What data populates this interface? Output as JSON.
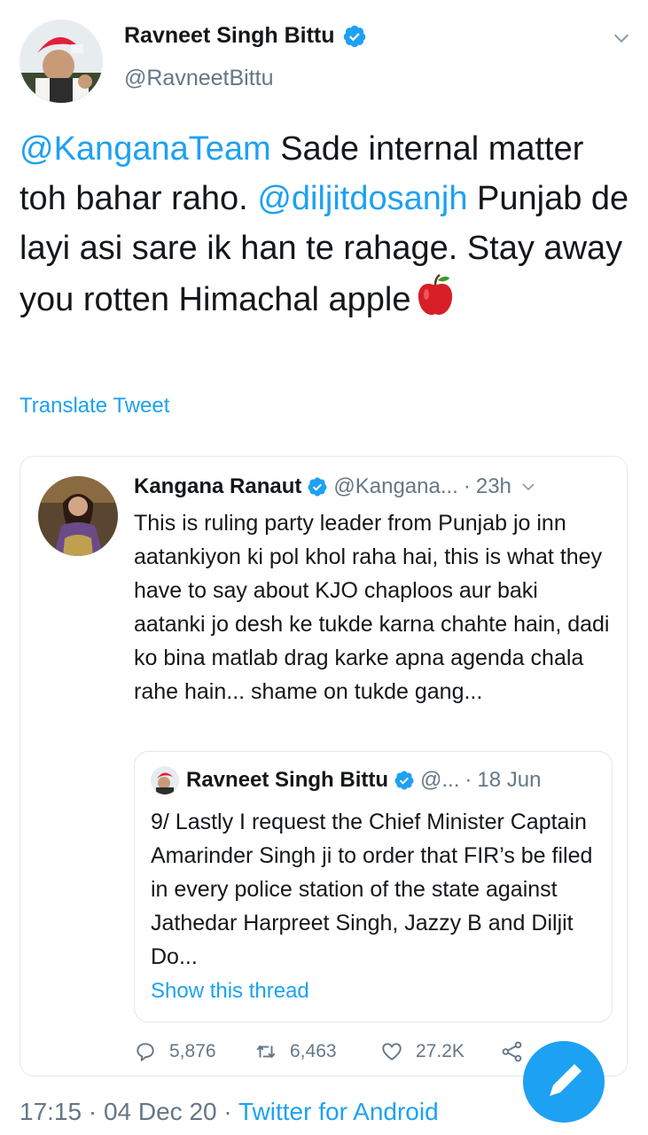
{
  "author": {
    "display_name": "Ravneet Singh Bittu",
    "handle": "@RavneetBittu"
  },
  "tweet": {
    "mention_1": "@KanganaTeam",
    "text_1": " Sade internal matter toh bahar raho. ",
    "mention_2": "@diljitdosanjh",
    "text_2": " Punjab de layi asi sare ik han te rahage. Stay away you rotten Himachal apple",
    "emoji": "red-apple-emoji"
  },
  "translate_label": "Translate Tweet",
  "quoted": {
    "display_name": "Kangana Ranaut",
    "handle": "@Kangana...",
    "separator": "·",
    "time": "23h",
    "text": "This is ruling party leader from Punjab jo inn aatankiyon ki pol khol raha hai, this is what they have to say about KJO chaploos aur baki aatanki jo desh ke tukde karna chahte hain, dadi ko bina matlab drag karke apna agenda chala rahe hain... shame on tukde gang...",
    "inner": {
      "display_name": "Ravneet Singh Bittu",
      "handle": "@...",
      "separator": "·",
      "time": "18 Jun",
      "text": "9/ Lastly I request the Chief Minister Captain Amarinder Singh ji to order that FIR’s be filed in every police station of the state against Jathedar Harpreet Singh, Jazzy B and Diljit Do...",
      "show_thread": "Show this thread"
    },
    "actions": {
      "replies": "5,876",
      "retweets": "6,463",
      "likes": "27.2K"
    }
  },
  "footer": {
    "time": "17:15",
    "separator_1": " · ",
    "date": "04 Dec 20",
    "separator_2": " · ",
    "source": "Twitter for Android"
  },
  "colors": {
    "accent": "#1da1f2",
    "text": "#14171a",
    "muted": "#657786",
    "border": "#e1e8ed"
  }
}
